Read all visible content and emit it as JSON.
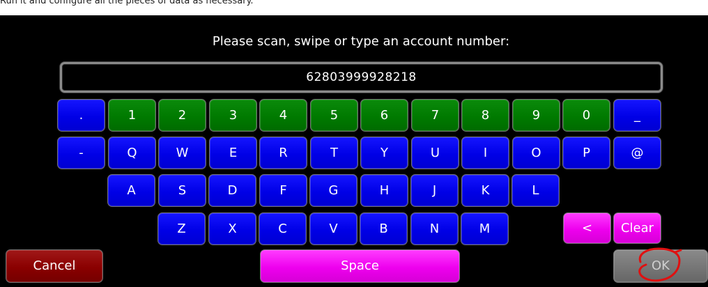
{
  "header_strip": {
    "text": "Run it and configure all the pieces of data as necessary."
  },
  "prompt": "Please scan, swipe or type an account number:",
  "account_number": "62803999928218",
  "colors": {
    "background": "#000000",
    "key_blue": "#0000e6",
    "key_green": "#007a00",
    "key_magenta": "#ee00ee",
    "cancel_red": "#8a0000",
    "ok_disabled_gray": "#767676",
    "annotation_red": "#e01010"
  },
  "keyboard": {
    "row1": [
      {
        "label": ".",
        "color": "blue"
      },
      {
        "label": "1",
        "color": "green"
      },
      {
        "label": "2",
        "color": "green"
      },
      {
        "label": "3",
        "color": "green"
      },
      {
        "label": "4",
        "color": "green"
      },
      {
        "label": "5",
        "color": "green"
      },
      {
        "label": "6",
        "color": "green"
      },
      {
        "label": "7",
        "color": "green"
      },
      {
        "label": "8",
        "color": "green"
      },
      {
        "label": "9",
        "color": "green"
      },
      {
        "label": "0",
        "color": "green"
      },
      {
        "label": "_",
        "color": "blue"
      }
    ],
    "row2": [
      {
        "label": "-",
        "color": "blue"
      },
      {
        "label": "Q",
        "color": "blue"
      },
      {
        "label": "W",
        "color": "blue"
      },
      {
        "label": "E",
        "color": "blue"
      },
      {
        "label": "R",
        "color": "blue"
      },
      {
        "label": "T",
        "color": "blue"
      },
      {
        "label": "Y",
        "color": "blue"
      },
      {
        "label": "U",
        "color": "blue"
      },
      {
        "label": "I",
        "color": "blue"
      },
      {
        "label": "O",
        "color": "blue"
      },
      {
        "label": "P",
        "color": "blue"
      },
      {
        "label": "@",
        "color": "blue"
      }
    ],
    "row3": [
      {
        "label": "A",
        "color": "blue"
      },
      {
        "label": "S",
        "color": "blue"
      },
      {
        "label": "D",
        "color": "blue"
      },
      {
        "label": "F",
        "color": "blue"
      },
      {
        "label": "G",
        "color": "blue"
      },
      {
        "label": "H",
        "color": "blue"
      },
      {
        "label": "J",
        "color": "blue"
      },
      {
        "label": "K",
        "color": "blue"
      },
      {
        "label": "L",
        "color": "blue"
      }
    ],
    "row4": [
      {
        "label": "Z",
        "color": "blue"
      },
      {
        "label": "X",
        "color": "blue"
      },
      {
        "label": "C",
        "color": "blue"
      },
      {
        "label": "V",
        "color": "blue"
      },
      {
        "label": "B",
        "color": "blue"
      },
      {
        "label": "N",
        "color": "blue"
      },
      {
        "label": "M",
        "color": "blue"
      }
    ],
    "backspace_label": "<",
    "clear_label": "Clear"
  },
  "bottom_bar": {
    "cancel_label": "Cancel",
    "space_label": "Space",
    "ok_label": "OK"
  }
}
